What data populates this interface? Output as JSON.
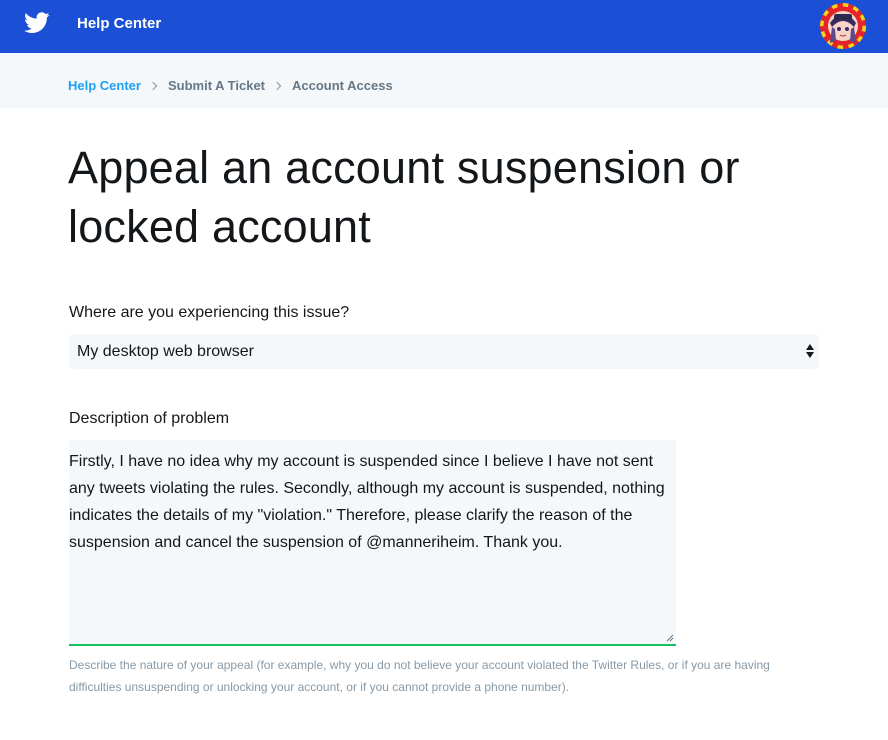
{
  "header": {
    "brand": "Help Center",
    "logo_icon": "twitter-bird-icon",
    "avatar_icon": "user-avatar",
    "bg_color": "#1a4fd6"
  },
  "breadcrumb": {
    "items": [
      "Help Center",
      "Submit A Ticket",
      "Account Access"
    ],
    "separator_icon": "chevron-right-icon"
  },
  "page": {
    "title": "Appeal an account suspension or locked account"
  },
  "form": {
    "issue_label": "Where are you experiencing this issue?",
    "issue_selected": "My desktop web browser",
    "description_label": "Description of problem",
    "description_value": "Firstly, I have no idea why my account is suspended since I believe I have not sent any tweets violating the rules. Secondly, although my account is suspended, nothing indicates the details of my \"violation.\" Therefore, please clarify the reason of the suspension and cancel the suspension of @manneriheim. Thank you.",
    "description_help": "Describe the nature of your appeal (for example, why you do not believe your account violated the Twitter Rules, or if you are having difficulties unsuspending or unlocking your account, or if you cannot provide a phone number).",
    "focus_color": "#17bf63"
  }
}
